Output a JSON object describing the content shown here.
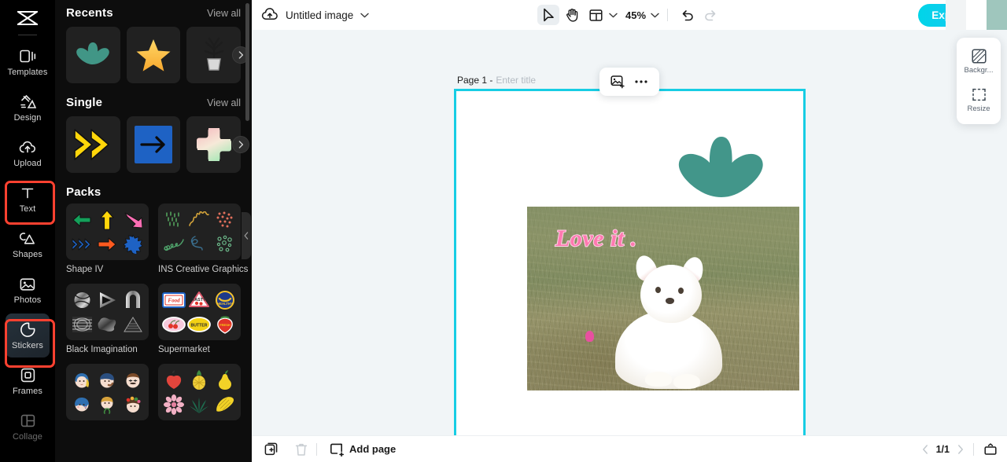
{
  "rail": {
    "logo_icon": "capcut-logo-icon",
    "items": [
      {
        "label": "Templates",
        "icon": "templates-icon",
        "state": "normal"
      },
      {
        "label": "Design",
        "icon": "design-icon",
        "state": "normal"
      },
      {
        "label": "Upload",
        "icon": "upload-cloud-icon",
        "state": "normal"
      },
      {
        "label": "Text",
        "icon": "text-icon",
        "state": "highlighted"
      },
      {
        "label": "Shapes",
        "icon": "shapes-icon",
        "state": "normal"
      },
      {
        "label": "Photos",
        "icon": "photos-icon",
        "state": "normal"
      },
      {
        "label": "Stickers",
        "icon": "stickers-icon",
        "state": "active-highlighted"
      },
      {
        "label": "Frames",
        "icon": "frames-icon",
        "state": "normal"
      },
      {
        "label": "Collage",
        "icon": "collage-icon",
        "state": "dim"
      }
    ],
    "highlight_color": "#ff4130"
  },
  "panel": {
    "sections": [
      {
        "title": "Recents",
        "view_all": "View all",
        "items": [
          {
            "name": "teal-leaf-sticker"
          },
          {
            "name": "yellow-star-sticker"
          },
          {
            "name": "potted-plant-sticker"
          }
        ],
        "next_arrow": "chevron-right-icon"
      },
      {
        "title": "Single",
        "view_all": "View all",
        "items": [
          {
            "name": "yellow-double-chevron-sticker"
          },
          {
            "name": "blue-arrow-square-sticker"
          },
          {
            "name": "gradient-clover-sticker"
          }
        ],
        "next_arrow": "chevron-right-icon"
      }
    ],
    "packs_title": "Packs",
    "packs": [
      {
        "name": "Shape IV"
      },
      {
        "name": "INS Creative Graphics"
      },
      {
        "name": "Black Imagination"
      },
      {
        "name": "Supermarket"
      },
      {
        "name": ""
      },
      {
        "name": ""
      }
    ],
    "collapse_icon": "chevron-left-icon"
  },
  "topbar": {
    "cloud_icon": "cloud-sync-icon",
    "doc_title": "Untitled image",
    "title_chevron": "chevron-down-icon",
    "tools": [
      {
        "name": "select-tool",
        "icon": "cursor-arrow-icon",
        "selected": true
      },
      {
        "name": "hand-tool",
        "icon": "hand-icon",
        "selected": false
      },
      {
        "name": "layout-tool",
        "icon": "layout-grid-icon",
        "selected": false
      }
    ],
    "layout_chevron": "chevron-down-icon",
    "zoom_value": "45%",
    "zoom_chevron": "chevron-down-icon",
    "undo_icon": "undo-icon",
    "redo_icon": "redo-icon",
    "export_label": "Export",
    "help_icon": "help-shield-icon"
  },
  "canvas": {
    "page_label": "Page 1 -",
    "title_placeholder": "Enter title",
    "float_tools": [
      {
        "name": "replace-image-button",
        "icon": "image-plus-icon"
      },
      {
        "name": "more-options-button",
        "icon": "ellipsis-icon"
      }
    ],
    "border_color": "#17cde4",
    "photo_text": "Love it ."
  },
  "right_panel": {
    "items": [
      {
        "label": "Backgr...",
        "icon": "background-icon"
      },
      {
        "label": "Resize",
        "icon": "resize-icon"
      }
    ]
  },
  "bottombar": {
    "duplicate_icon": "duplicate-page-icon",
    "delete_icon": "trash-icon",
    "add_page_icon": "add-page-icon",
    "add_page_label": "Add page",
    "prev_icon": "chevron-left-icon",
    "page_indicator": "1/1",
    "next_icon": "chevron-right-icon",
    "timeline_icon": "pages-panel-icon"
  }
}
